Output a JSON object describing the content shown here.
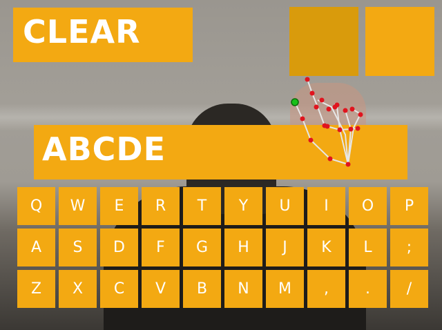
{
  "clear_button": {
    "label": "CLEAR"
  },
  "typed_text": "ABCDE",
  "keyboard": {
    "rows": [
      [
        "Q",
        "W",
        "E",
        "R",
        "T",
        "Y",
        "U",
        "I",
        "O",
        "P"
      ],
      [
        "A",
        "S",
        "D",
        "F",
        "G",
        "H",
        "J",
        "K",
        "L",
        ";"
      ],
      [
        "Z",
        "X",
        "C",
        "V",
        "B",
        "N",
        "M",
        ",",
        ".",
        "/"
      ]
    ]
  },
  "colors": {
    "button": "#f3a912",
    "button_active": "#d99b0c",
    "text": "#ffffff",
    "landmark_point": "#e0141e",
    "landmark_line": "#e6e6e6",
    "fingertip_cursor": "#18c018"
  }
}
